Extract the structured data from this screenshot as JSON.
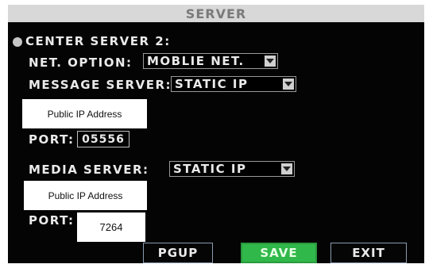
{
  "title": "SERVER",
  "section_label": "CENTER SERVER 2:",
  "net_option": {
    "label": "NET. OPTION:",
    "value": "MOBLIE NET."
  },
  "message_server": {
    "label": "MESSAGE SERVER:",
    "value": "STATIC IP",
    "address": "Public IP Address",
    "port_label": "PORT:",
    "port_value": "05556"
  },
  "media_server": {
    "label": "MEDIA SERVER:",
    "value": "STATIC IP",
    "address": "Public IP Address",
    "port_label": "PORT:",
    "port_value": "7264"
  },
  "buttons": {
    "pgup": "PGUP",
    "save": "SAVE",
    "exit": "EXIT"
  },
  "colors": {
    "background": "#040404",
    "title_bar": "#d8d8d8",
    "save_button": "#31b84a",
    "text": "#eaeaea"
  }
}
